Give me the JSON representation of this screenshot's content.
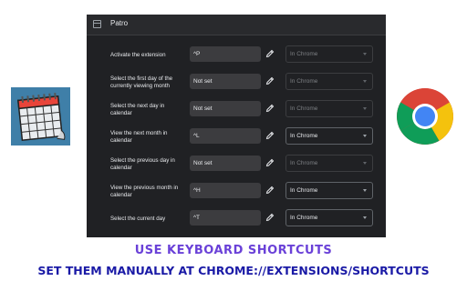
{
  "app": {
    "title": "Patro"
  },
  "shortcuts": [
    {
      "label": "Activate the extension",
      "key": "^P",
      "scope": "In Chrome",
      "scope_enabled": false
    },
    {
      "label": "Select the first day of the currently viewing month",
      "key": "Not set",
      "scope": "In Chrome",
      "scope_enabled": false
    },
    {
      "label": "Select the next day in calendar",
      "key": "Not set",
      "scope": "In Chrome",
      "scope_enabled": false
    },
    {
      "label": "View the next month in calendar",
      "key": "^L",
      "scope": "In Chrome",
      "scope_enabled": true
    },
    {
      "label": "Select the previous day in calendar",
      "key": "Not set",
      "scope": "In Chrome",
      "scope_enabled": false
    },
    {
      "label": "View the previous month in calendar",
      "key": "^H",
      "scope": "In Chrome",
      "scope_enabled": true
    },
    {
      "label": "Select the current day",
      "key": "^T",
      "scope": "In Chrome",
      "scope_enabled": true
    }
  ],
  "icons": {
    "header": "extension-window-icon",
    "edit": "pencil-icon",
    "dropdown": "chevron-down-icon",
    "left_logo": "calendar-icon",
    "right_logo": "chrome-logo-icon"
  },
  "captions": {
    "headline": "USE KEYBOARD SHORTCUTS",
    "subline": "SET THEM MANUALLY AT CHROME://EXTENSIONS/SHORTCUTS"
  },
  "colors": {
    "panel_bg": "#202124",
    "headline": "#6a41d8",
    "subline": "#1a1aa6",
    "calendar_bg": "#3f7fa8"
  }
}
